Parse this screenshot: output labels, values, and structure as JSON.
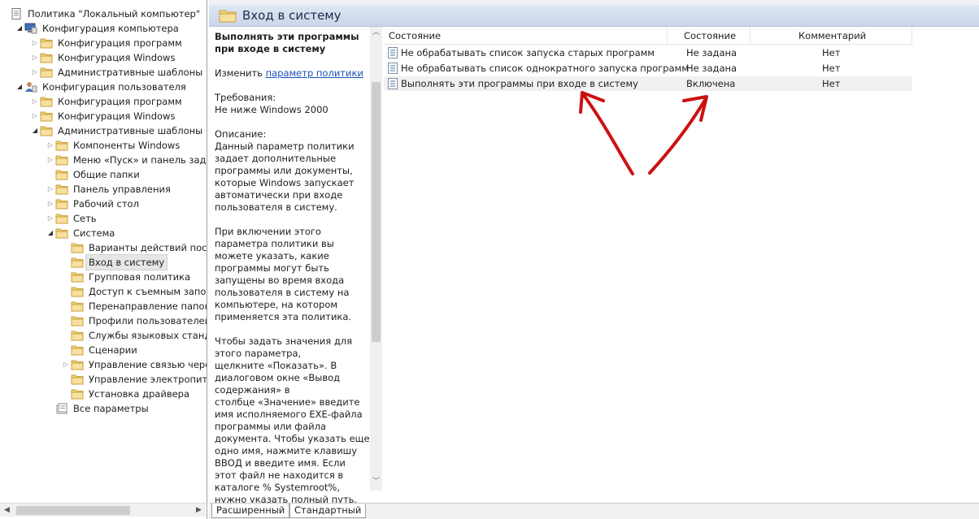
{
  "tree": {
    "items": [
      {
        "label": "Политика \"Локальный компьютер\"",
        "icon": "policy-doc-icon",
        "twist": "none"
      },
      {
        "label": "Конфигурация компьютера",
        "icon": "computer-icon",
        "twist": "open"
      },
      {
        "label": "Конфигурация программ",
        "icon": "folder-icon",
        "twist": "closed"
      },
      {
        "label": "Конфигурация Windows",
        "icon": "folder-icon",
        "twist": "closed"
      },
      {
        "label": "Административные шаблоны",
        "icon": "folder-icon",
        "twist": "closed"
      },
      {
        "label": "Конфигурация пользователя",
        "icon": "user-icon",
        "twist": "open"
      },
      {
        "label": "Конфигурация программ",
        "icon": "folder-icon",
        "twist": "closed"
      },
      {
        "label": "Конфигурация Windows",
        "icon": "folder-icon",
        "twist": "closed"
      },
      {
        "label": "Административные шаблоны",
        "icon": "folder-icon",
        "twist": "open"
      },
      {
        "label": "Компоненты Windows",
        "icon": "folder-icon",
        "twist": "closed"
      },
      {
        "label": "Меню «Пуск» и панель задач",
        "icon": "folder-icon",
        "twist": "closed"
      },
      {
        "label": "Общие папки",
        "icon": "folder-icon",
        "twist": "none"
      },
      {
        "label": "Панель управления",
        "icon": "folder-icon",
        "twist": "closed"
      },
      {
        "label": "Рабочий стол",
        "icon": "folder-icon",
        "twist": "closed"
      },
      {
        "label": "Сеть",
        "icon": "folder-icon",
        "twist": "closed"
      },
      {
        "label": "Система",
        "icon": "folder-icon",
        "twist": "open"
      },
      {
        "label": "Варианты действий после",
        "icon": "folder-icon",
        "twist": "none"
      },
      {
        "label": "Вход в систему",
        "icon": "folder-icon",
        "twist": "none"
      },
      {
        "label": "Групповая политика",
        "icon": "folder-icon",
        "twist": "none"
      },
      {
        "label": "Доступ к съемным запоми",
        "icon": "folder-icon",
        "twist": "none"
      },
      {
        "label": "Перенаправление папок",
        "icon": "folder-icon",
        "twist": "none"
      },
      {
        "label": "Профили пользователей",
        "icon": "folder-icon",
        "twist": "none"
      },
      {
        "label": "Службы языковых стандар",
        "icon": "folder-icon",
        "twist": "none"
      },
      {
        "label": "Сценарии",
        "icon": "folder-icon",
        "twist": "none"
      },
      {
        "label": "Управление связью через",
        "icon": "folder-icon",
        "twist": "closed"
      },
      {
        "label": "Управление электропитан",
        "icon": "folder-icon",
        "twist": "none"
      },
      {
        "label": "Установка драйвера",
        "icon": "folder-icon",
        "twist": "none"
      },
      {
        "label": "Все параметры",
        "icon": "all-settings-icon",
        "twist": "none"
      }
    ],
    "selected_index": 17
  },
  "header": {
    "title": "Вход в систему"
  },
  "description": {
    "title": "Выполнять эти программы при входе в систему",
    "edit_prefix": "Изменить",
    "edit_link": "параметр политики",
    "requirements_label": "Требования:",
    "requirements_value": "Не ниже Windows 2000",
    "desc_label": "Описание:",
    "desc_text": "Данный параметр политики задает дополнительные программы или документы, которые Windows запускает автоматически при входе пользователя в систему.",
    "p2": "При включении этого параметра политики вы можете указать, какие программы могут быть запущены во время входа пользователя в систему на компьютере, на котором применяется эта политика.",
    "p3_a": "Чтобы задать значения для этого параметра,",
    "p3_b": "щелкните «Показать». В диалоговом окне «Вывод содержания» в",
    "p3_c": "столбце «Значение» введите имя исполняемого EXE-файла программы или файла документа. Чтобы указать еще одно имя, нажмите клавишу ВВОД и введите имя. Если этот файл не находится в каталоге % Systemroot%, нужно указать полный путь."
  },
  "list": {
    "columns": [
      "Состояние",
      "Состояние",
      "Комментарий"
    ],
    "rows": [
      {
        "name": "Не обрабатывать список запуска старых программ",
        "state": "Не задана",
        "comment": "Нет"
      },
      {
        "name": "Не обрабатывать список однократного запуска программ",
        "state": "Не задана",
        "comment": "Нет"
      },
      {
        "name": "Выполнять эти программы при входе в систему",
        "state": "Включена",
        "comment": "Нет"
      }
    ],
    "selected_index": 2
  },
  "tabs": [
    "Расширенный",
    "Стандартный"
  ],
  "colors": {
    "annotation_arrows": "#cc1111",
    "link": "#1a4fb8",
    "header_bg": "#d3deee"
  }
}
